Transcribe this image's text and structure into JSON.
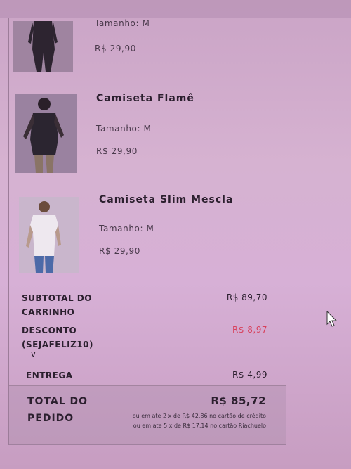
{
  "cart": {
    "items": [
      {
        "name": "",
        "size": "Tamanho: M",
        "price": "R$ 29,90"
      },
      {
        "name": "Camiseta Flamê",
        "size": "Tamanho: M",
        "price": "R$ 29,90"
      },
      {
        "name": "Camiseta Slim Mescla",
        "size": "Tamanho: M",
        "price": "R$ 29,90"
      }
    ]
  },
  "summary": {
    "subtotal_label": "SUBTOTAL DO CARRINHO",
    "subtotal_value": "R$ 89,70",
    "discount_label": "DESCONTO (SEJAFELIZ10)",
    "discount_value": "-R$ 8,97",
    "shipping_label": "ENTREGA",
    "shipping_value": "R$ 4,99",
    "total_label": "TOTAL DO PEDIDO",
    "total_value": "R$ 85,72",
    "installment_credit": "ou em ate 2 x de R$ 42,86 no cartão de crédito",
    "installment_store": "ou em ate 5 x de R$ 17,14 no cartão Riachuelo"
  },
  "colors": {
    "discount": "#d8405b"
  },
  "icons": {
    "expand": "chevron-down-icon",
    "cursor": "mouse-pointer-icon"
  }
}
